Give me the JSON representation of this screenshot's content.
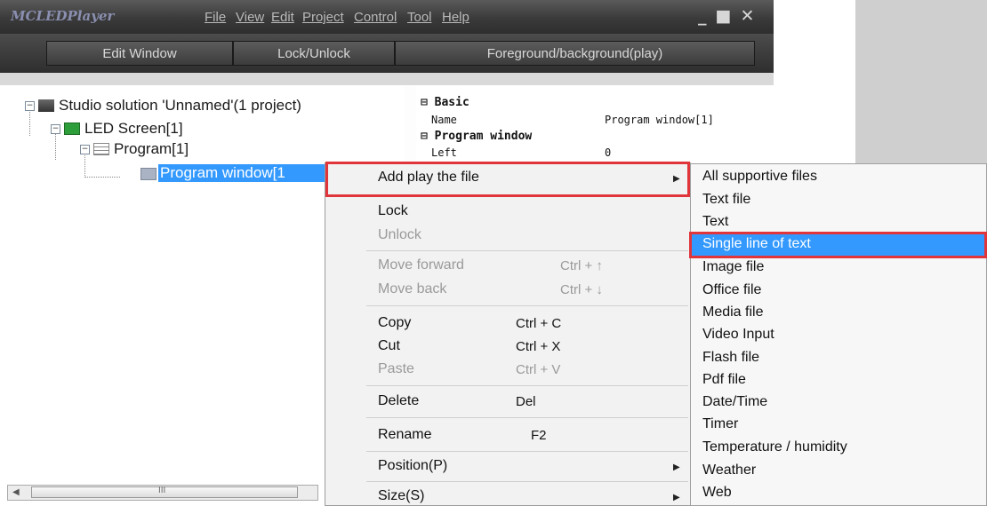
{
  "app": {
    "title": "MCLEDPlayer",
    "menu": [
      "File",
      "View",
      "Edit",
      "Project",
      "Control",
      "Tool",
      "Help"
    ],
    "window_controls": "_ ■ ✕"
  },
  "toolbar": {
    "edit_window": "Edit Window",
    "lock_unlock": "Lock/Unlock",
    "foreground_background": "Foreground/background(play)"
  },
  "tree": {
    "solution": "Studio solution 'Unnamed'(1 project)",
    "screen": "LED Screen[1]",
    "program": "Program[1]",
    "program_window": "Program window[1"
  },
  "properties": {
    "basic_header": "Basic",
    "name_key": "Name",
    "name_value": "Program window[1]",
    "pw_header": "Program window",
    "left_key": "Left",
    "left_value": "0"
  },
  "scrollbar": {
    "thumb_glyph": "III"
  },
  "context_menu": {
    "add_play_file": "Add play the file",
    "lock": "Lock",
    "unlock": "Unlock",
    "move_forward": "Move forward",
    "move_forward_sc": "Ctrl + ↑",
    "move_back": "Move back",
    "move_back_sc": "Ctrl + ↓",
    "copy": "Copy",
    "copy_sc": "Ctrl + C",
    "cut": "Cut",
    "cut_sc": "Ctrl + X",
    "paste": "Paste",
    "paste_sc": "Ctrl + V",
    "delete": "Delete",
    "delete_sc": "Del",
    "rename": "Rename",
    "rename_sc": "F2",
    "position": "Position(P)",
    "size": "Size(S)"
  },
  "submenu": {
    "items": [
      "All supportive files",
      "Text file",
      "Text",
      "Single line of text",
      "Image file",
      "Office file",
      "Media file",
      "Video Input",
      "Flash file",
      "Pdf file",
      "Date/Time",
      "Timer",
      "Temperature / humidity",
      "Weather",
      "Web"
    ],
    "highlighted": "Single line of text"
  },
  "colors": {
    "highlight": "#3399ff",
    "annotation_red": "#e0353a",
    "titlebar": "#3a3a3a"
  }
}
